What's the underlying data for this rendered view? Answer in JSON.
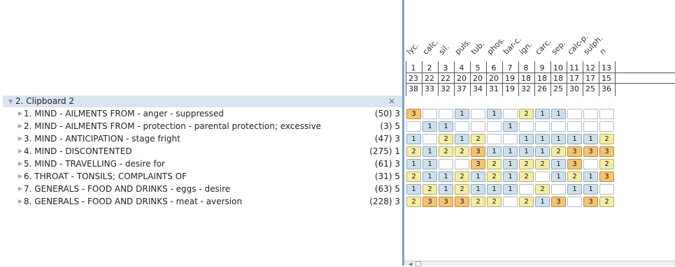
{
  "clipboard": {
    "title": "2. Clipboard 2",
    "close_icon": "×"
  },
  "rubrics": [
    {
      "label": "1. MIND - AILMENTS FROM - anger - suppressed",
      "count": "(50) 3"
    },
    {
      "label": "2. MIND - AILMENTS FROM - protection - parental protection; excessive",
      "count": "(3) 5"
    },
    {
      "label": "3. MIND - ANTICIPATION - stage fright",
      "count": "(47) 3"
    },
    {
      "label": "4. MIND - DISCONTENTED",
      "count": "(275) 1"
    },
    {
      "label": "5. MIND - TRAVELLING - desire for",
      "count": "(61) 3"
    },
    {
      "label": "6. THROAT - TONSILS; COMPLAINTS OF",
      "count": "(31) 5"
    },
    {
      "label": "7. GENERALS - FOOD AND DRINKS - eggs - desire",
      "count": "(63) 5"
    },
    {
      "label": "8. GENERALS - FOOD AND DRINKS - meat - aversion",
      "count": "(228) 3"
    }
  ],
  "remedies": [
    "lyc.",
    "calc.",
    "sil.",
    "puls.",
    "tub.",
    "phos.",
    "bar-c.",
    "ign.",
    "carc.",
    "sep.",
    "calc-p.",
    "sulph.",
    "n"
  ],
  "rank_row": [
    "1",
    "2",
    "3",
    "4",
    "5",
    "6",
    "7",
    "8",
    "9",
    "10",
    "11",
    "12",
    "13"
  ],
  "count_row": [
    "23",
    "22",
    "22",
    "20",
    "20",
    "20",
    "19",
    "18",
    "18",
    "18",
    "17",
    "17",
    "15"
  ],
  "degree_row": [
    "38",
    "33",
    "32",
    "37",
    "34",
    "31",
    "19",
    "32",
    "26",
    "25",
    "30",
    "25",
    "36"
  ],
  "grades": [
    [
      "3",
      "",
      "",
      "1",
      "",
      "1",
      "",
      "2",
      "1",
      "1",
      "",
      "",
      ""
    ],
    [
      "",
      "1",
      "1",
      "",
      "",
      "",
      "1",
      "",
      "",
      "",
      "",
      "",
      ""
    ],
    [
      "1",
      "",
      "2",
      "1",
      "2",
      "",
      "",
      "1",
      "1",
      "1",
      "1",
      "1",
      "2"
    ],
    [
      "2",
      "1",
      "2",
      "2",
      "3",
      "1",
      "1",
      "1",
      "1",
      "2",
      "3",
      "3",
      "3"
    ],
    [
      "1",
      "1",
      "",
      "",
      "3",
      "2",
      "1",
      "2",
      "2",
      "1",
      "3",
      "",
      "2"
    ],
    [
      "2",
      "1",
      "1",
      "2",
      "1",
      "2",
      "1",
      "2",
      "",
      "1",
      "2",
      "1",
      "3"
    ],
    [
      "1",
      "2",
      "1",
      "2",
      "1",
      "1",
      "1",
      "",
      "2",
      "",
      "1",
      "1",
      ""
    ],
    [
      "2",
      "3",
      "3",
      "3",
      "2",
      "2",
      "",
      "2",
      "1",
      "3",
      "",
      "3",
      "2"
    ]
  ]
}
